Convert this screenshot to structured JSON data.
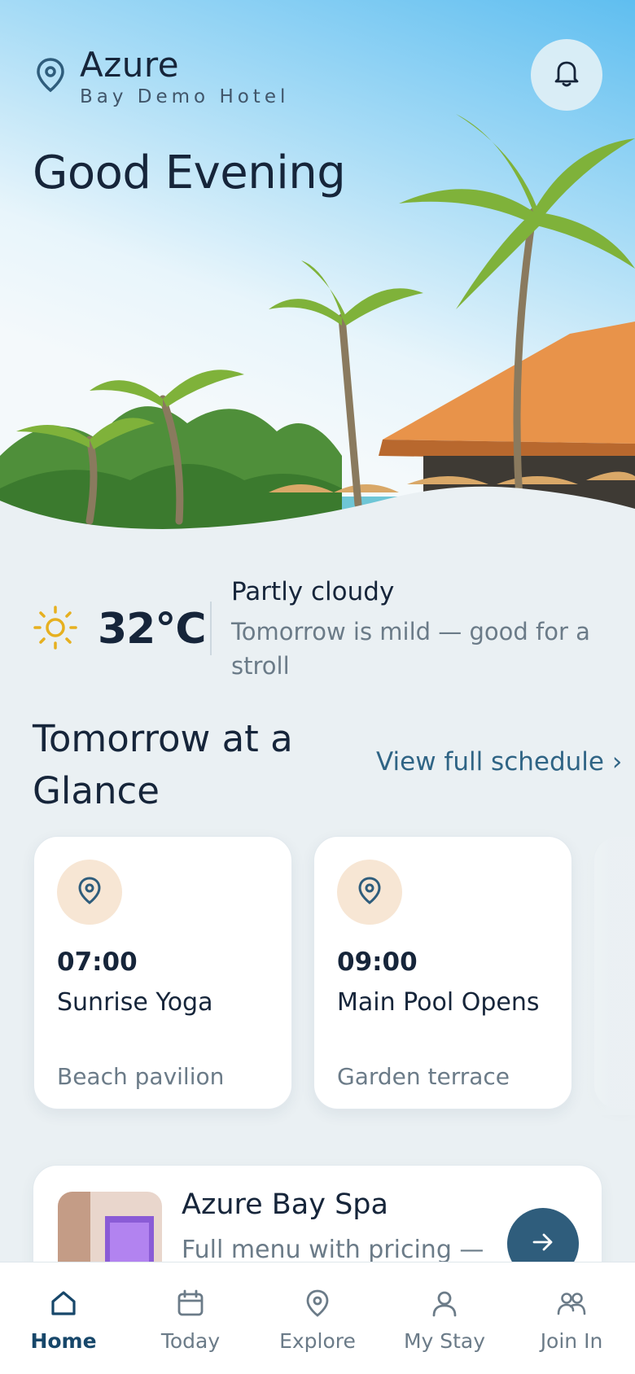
{
  "header": {
    "hotel_name": "Azure",
    "hotel_subtitle": "Bay Demo Hotel",
    "greeting": "Good Evening"
  },
  "weather": {
    "temperature": "32°C",
    "condition": "Partly cloudy",
    "forecast_note": "Tomorrow is mild — good for a stroll",
    "icon": "sun-icon"
  },
  "glance": {
    "title": "Tomorrow at a Glance",
    "link_label": "View full schedule ›",
    "events": [
      {
        "time": "07:00",
        "title": "Sunrise Yoga",
        "place": "Beach pavilion",
        "icon": "pin-icon"
      },
      {
        "time": "09:00",
        "title": "Main Pool Opens",
        "place": "Garden terrace",
        "icon": "pin-icon"
      }
    ]
  },
  "spa": {
    "title": "Azure Bay Spa",
    "subtitle": "Full menu with pricing —"
  },
  "nav": {
    "items": [
      {
        "label": "Home",
        "icon": "home-icon",
        "active": true
      },
      {
        "label": "Today",
        "icon": "calendar-icon",
        "active": false
      },
      {
        "label": "Explore",
        "icon": "pin-icon",
        "active": false
      },
      {
        "label": "My Stay",
        "icon": "person-icon",
        "active": false
      },
      {
        "label": "Join In",
        "icon": "people-icon",
        "active": false
      }
    ]
  },
  "colors": {
    "accent": "#2f5d7c",
    "active_nav": "#17476a",
    "icon_bg": "#f7e6d4",
    "sun": "#e6b020"
  }
}
